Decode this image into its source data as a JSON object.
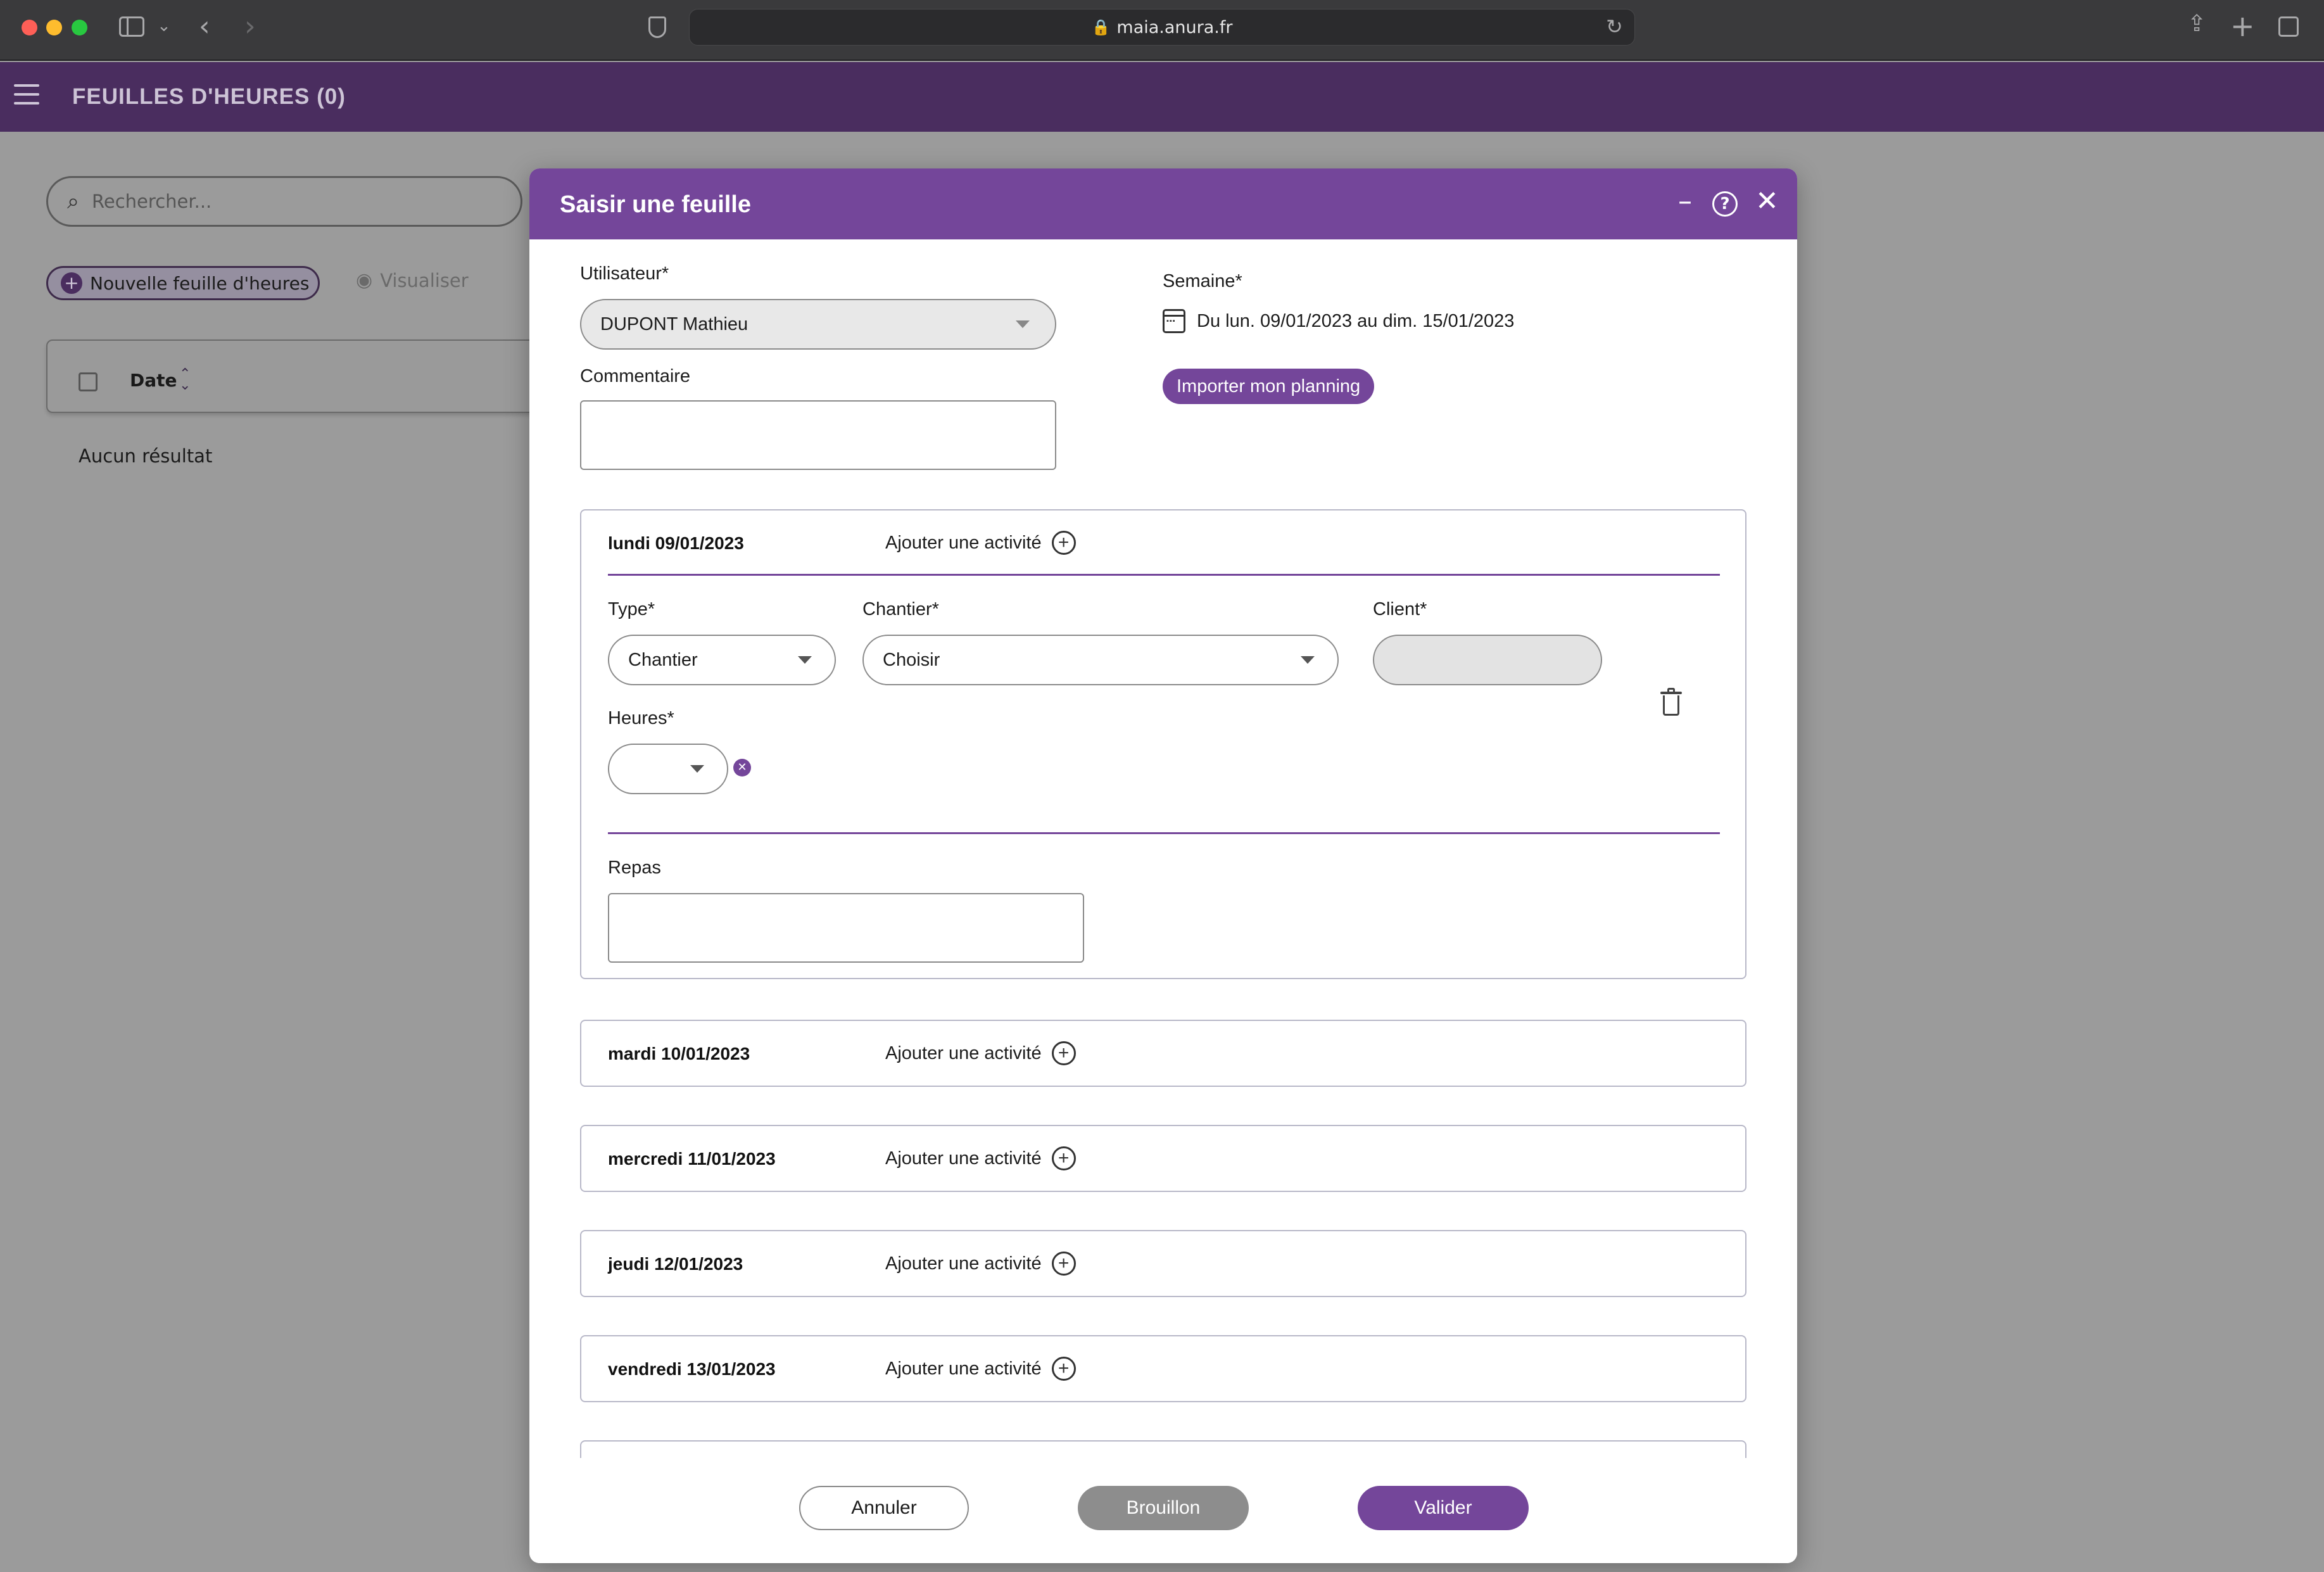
{
  "browser": {
    "url": "maia.anura.fr"
  },
  "app": {
    "title": "FEUILLES D'HEURES (0)",
    "search_placeholder": "Rechercher...",
    "new_sheet_label": "Nouvelle feuille d'heures",
    "view_label": "Visualiser",
    "table": {
      "date_header": "Date",
      "empty_text": "Aucun résultat"
    }
  },
  "modal": {
    "title": "Saisir une feuille",
    "user": {
      "label": "Utilisateur*",
      "value": "DUPONT Mathieu"
    },
    "comment": {
      "label": "Commentaire",
      "value": ""
    },
    "week": {
      "label": "Semaine*",
      "value": "Du lun. 09/01/2023 au dim. 15/01/2023"
    },
    "import_label": "Importer mon planning",
    "add_activity_label": "Ajouter une activité",
    "days": [
      {
        "title": "lundi 09/01/2023"
      },
      {
        "title": "mardi 10/01/2023"
      },
      {
        "title": "mercredi 11/01/2023"
      },
      {
        "title": "jeudi 12/01/2023"
      },
      {
        "title": "vendredi 13/01/2023"
      }
    ],
    "activity": {
      "type_label": "Type*",
      "type_value": "Chantier",
      "site_label": "Chantier*",
      "site_value": "Choisir",
      "client_label": "Client*",
      "client_value": "",
      "hours_label": "Heures*",
      "hours_value": ""
    },
    "meals": {
      "label": "Repas",
      "value": ""
    },
    "footer": {
      "cancel": "Annuler",
      "draft": "Brouillon",
      "validate": "Valider"
    }
  },
  "colors": {
    "brand_purple": "#74469a",
    "header_dimmed": "#4a2d5f",
    "draft_gray": "#8d8d8d"
  }
}
